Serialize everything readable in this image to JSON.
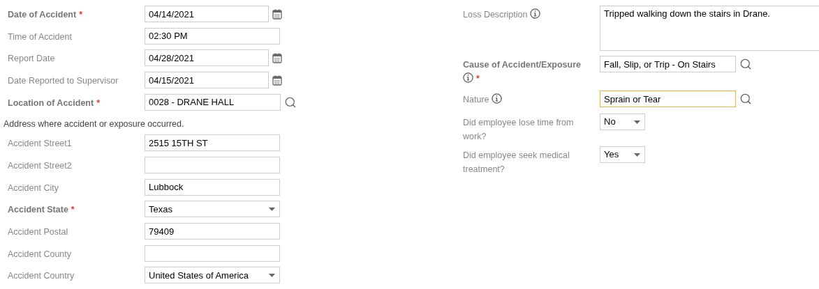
{
  "left_fields": [
    {
      "kind": "date",
      "label": "Date of Accident",
      "required": true,
      "required_mark": "*",
      "value": "04/14/2021"
    },
    {
      "kind": "text",
      "label": "Time of Accident",
      "required": false,
      "value": "02:30 PM"
    },
    {
      "kind": "date",
      "label": "Report Date",
      "required": false,
      "value": "04/28/2021"
    },
    {
      "kind": "date",
      "label": "Date Reported to Supervisor",
      "required": false,
      "value": "04/15/2021"
    },
    {
      "kind": "lookup",
      "label": "Location of Accident",
      "required": true,
      "required_mark": "*",
      "value": "0028 - DRANE HALL"
    },
    {
      "kind": "note",
      "label": "Address where accident or exposure occurred."
    },
    {
      "kind": "text",
      "label": "Accident Street1",
      "required": false,
      "value": "2515 15TH ST"
    },
    {
      "kind": "text",
      "label": "Accident Street2",
      "required": false
    },
    {
      "kind": "text",
      "label": "Accident City",
      "required": false,
      "value": "Lubbock"
    },
    {
      "kind": "select",
      "label": "Accident State",
      "required": true,
      "required_mark": "*",
      "value": "Texas"
    },
    {
      "kind": "text",
      "label": "Accident Postal",
      "required": false,
      "value": "79409"
    },
    {
      "kind": "text",
      "label": "Accident County",
      "required": false
    },
    {
      "kind": "select",
      "label": "Accident Country",
      "required": false,
      "value": "United States of America"
    }
  ],
  "right_fields": [
    {
      "kind": "textarea",
      "label": "Loss Description",
      "info": true,
      "required": false,
      "value": "Tripped walking down the stairs in Drane."
    },
    {
      "kind": "lookup",
      "label": "Cause of Accident/Exposure",
      "info": true,
      "required": true,
      "required_mark": "*",
      "focused": false,
      "value": "Fall, Slip, or Trip - On Stairs"
    },
    {
      "kind": "lookup",
      "label": "Nature",
      "info": true,
      "required": false,
      "focused": true,
      "value": "Sprain or Tear"
    },
    {
      "kind": "small_select",
      "label": "Did employee lose time from work?",
      "info": false,
      "required": false,
      "value": "No"
    },
    {
      "kind": "small_select",
      "label": "Did employee seek medical treatment?",
      "info": false,
      "required": false,
      "value": "Yes"
    }
  ]
}
